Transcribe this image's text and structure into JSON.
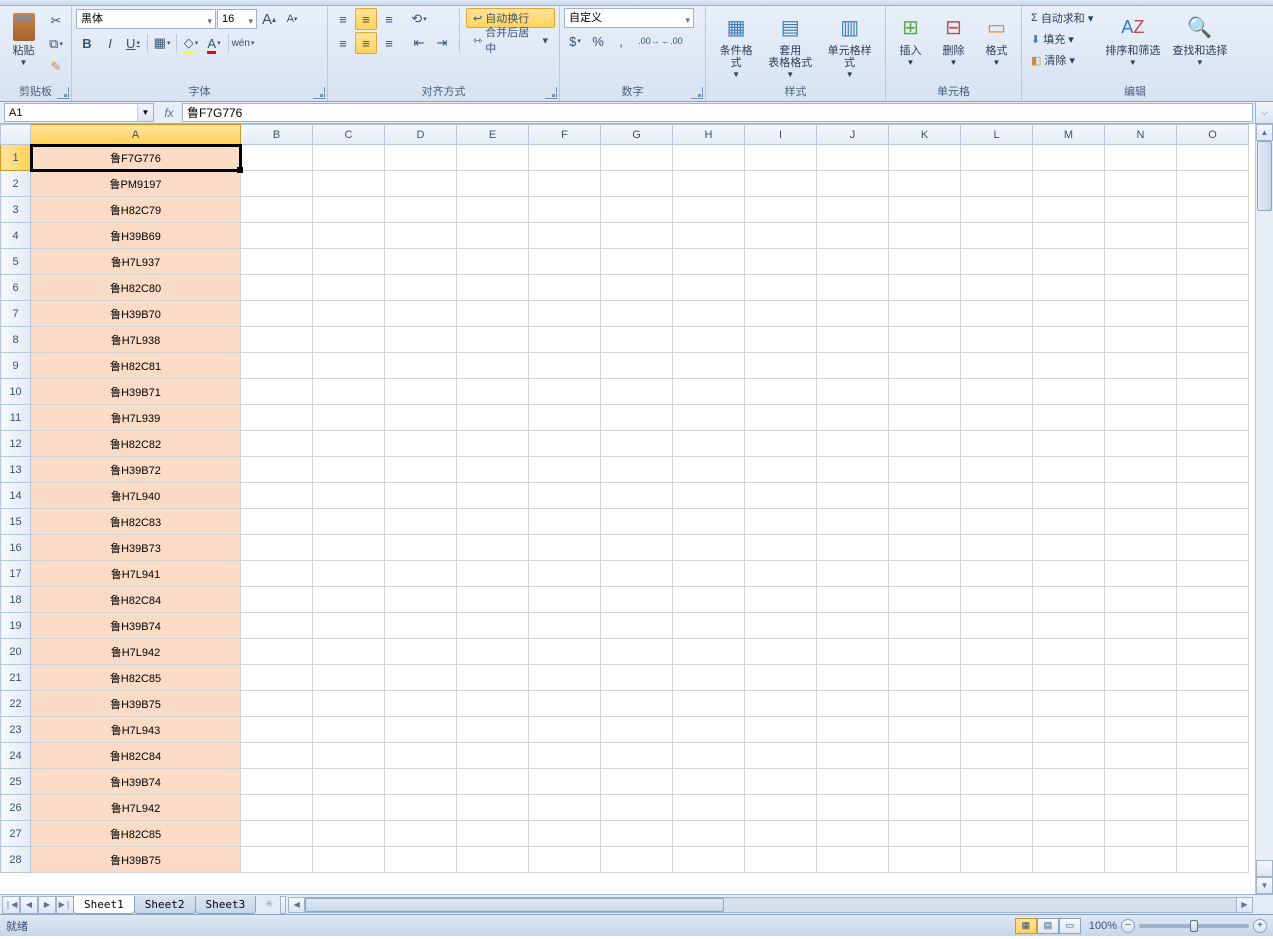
{
  "ribbon": {
    "clipboard": {
      "label": "剪贴板",
      "paste": "粘贴"
    },
    "font": {
      "label": "字体",
      "name": "黑体",
      "size": "16",
      "growA": "A",
      "shrinkA": "A",
      "bold": "B",
      "italic": "I",
      "underline": "U"
    },
    "align": {
      "label": "对齐方式",
      "wrap": "自动换行",
      "merge": "合并后居中"
    },
    "number": {
      "label": "数字",
      "format": "自定义"
    },
    "styles": {
      "label": "样式",
      "condfmt": "条件格式",
      "tablefmt": "套用\n表格格式",
      "cellstyle": "单元格样式"
    },
    "cells": {
      "label": "单元格",
      "insert": "插入",
      "delete": "删除",
      "format": "格式"
    },
    "editing": {
      "label": "编辑",
      "autosum": "自动求和",
      "fill": "填充",
      "clear": "清除",
      "sort": "排序和筛选",
      "find": "查找和选择"
    }
  },
  "namebox": "A1",
  "formula": "鲁F7G776",
  "columns": [
    "A",
    "B",
    "C",
    "D",
    "E",
    "F",
    "G",
    "H",
    "I",
    "J",
    "K",
    "L",
    "M",
    "N",
    "O"
  ],
  "colA_width": 210,
  "other_col_width": 72,
  "rows": [
    "鲁F7G776",
    "鲁PM9197",
    "鲁H82C79",
    "鲁H39B69",
    "鲁H7L937",
    "鲁H82C80",
    "鲁H39B70",
    "鲁H7L938",
    "鲁H82C81",
    "鲁H39B71",
    "鲁H7L939",
    "鲁H82C82",
    "鲁H39B72",
    "鲁H7L940",
    "鲁H82C83",
    "鲁H39B73",
    "鲁H7L941",
    "鲁H82C84",
    "鲁H39B74",
    "鲁H7L942",
    "鲁H82C85",
    "鲁H39B75",
    "鲁H7L943",
    "鲁H82C84",
    "鲁H39B74",
    "鲁H7L942",
    "鲁H82C85",
    "鲁H39B75"
  ],
  "selected": {
    "col": "A",
    "row": 1
  },
  "sheets": [
    "Sheet1",
    "Sheet2",
    "Sheet3"
  ],
  "active_sheet": 0,
  "status": {
    "ready": "就绪",
    "zoom": "100%"
  }
}
